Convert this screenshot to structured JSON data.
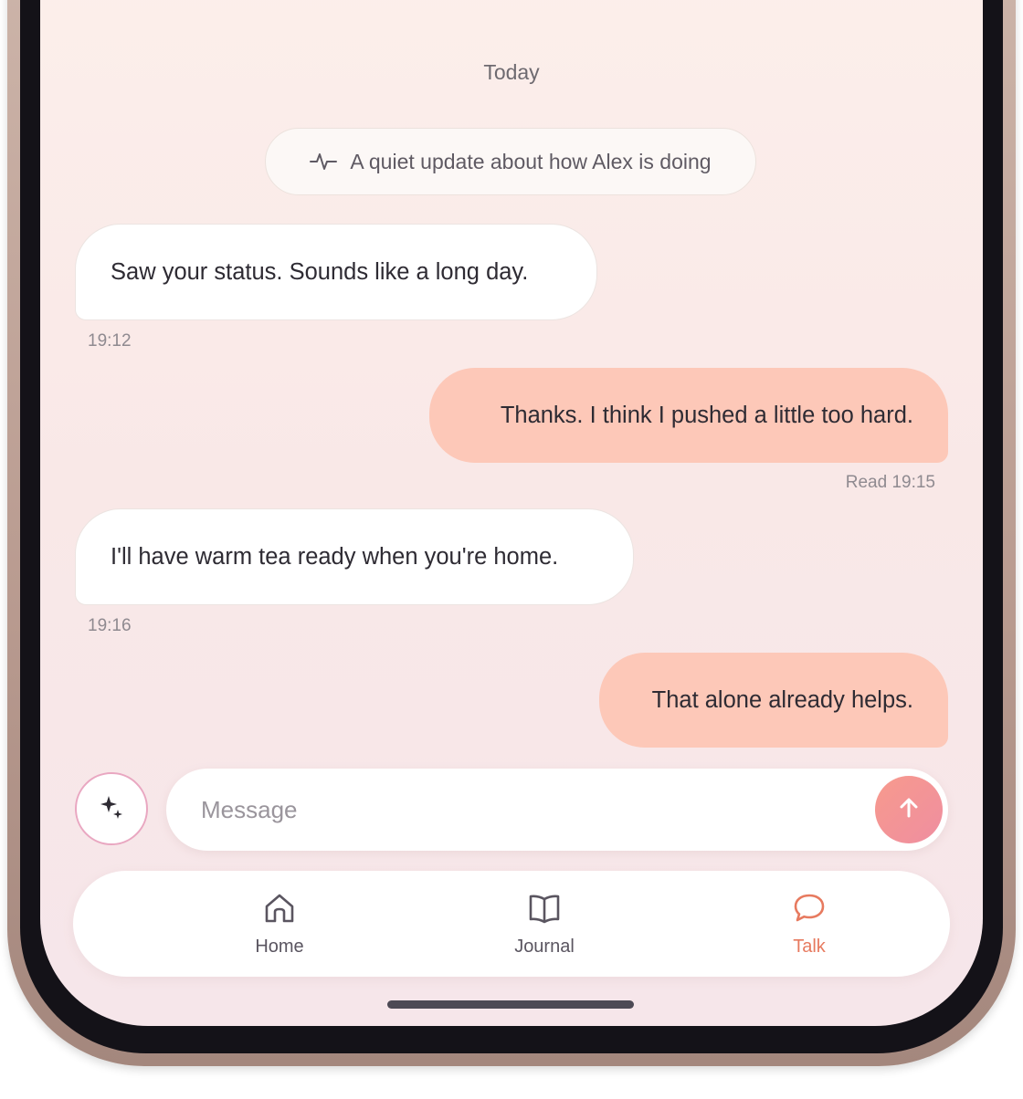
{
  "conversation": {
    "date_label": "Today",
    "status_update": {
      "icon": "activity-pulse-icon",
      "text": "A quiet update about how Alex is doing"
    },
    "messages": [
      {
        "direction": "incoming",
        "text": "Saw your status. Sounds like a long day.",
        "meta": "19:12"
      },
      {
        "direction": "outgoing",
        "text": "Thanks. I think I pushed a little too hard.",
        "meta": "Read 19:15"
      },
      {
        "direction": "incoming",
        "text": "I'll have warm tea ready when you're home.",
        "meta": "19:16"
      },
      {
        "direction": "outgoing",
        "text": "That alone already helps.",
        "meta": ""
      }
    ]
  },
  "composer": {
    "ai_button_icon": "sparkles-icon",
    "placeholder": "Message",
    "value": "",
    "send_icon": "arrow-up-icon"
  },
  "nav": {
    "items": [
      {
        "label": "Home",
        "icon": "home-icon",
        "active": false
      },
      {
        "label": "Journal",
        "icon": "book-open-icon",
        "active": false
      },
      {
        "label": "Talk",
        "icon": "chat-bubble-icon",
        "active": true
      }
    ]
  },
  "colors": {
    "outgoing_bubble": "#fdc8b8",
    "incoming_bubble": "#ffffff",
    "accent": "#e77a5f",
    "send_button": "#f79a8d"
  }
}
